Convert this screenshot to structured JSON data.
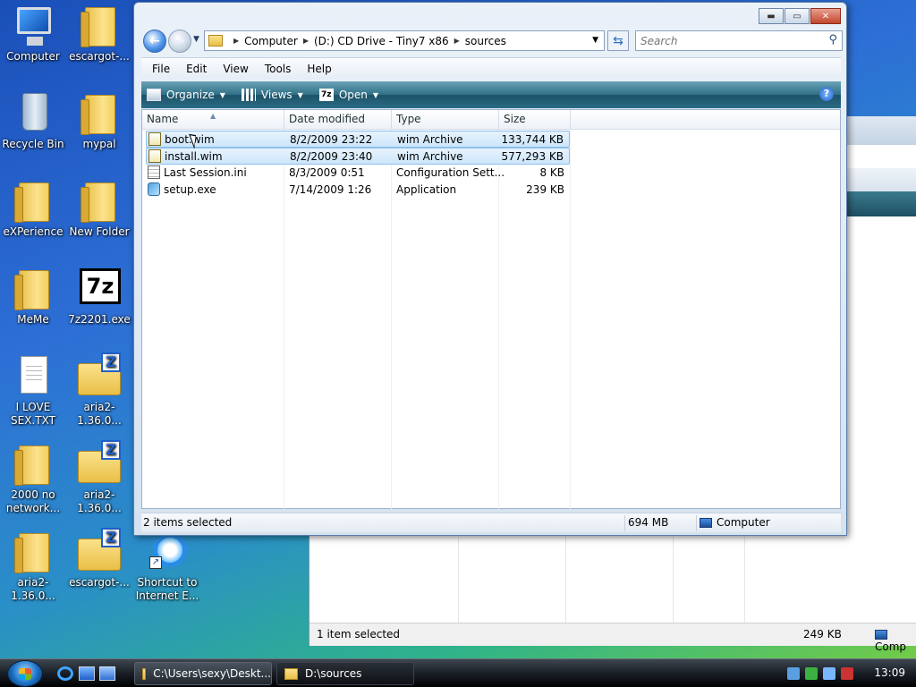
{
  "desktop": {
    "icons": [
      {
        "label": "Computer"
      },
      {
        "label": "escargot-..."
      },
      {
        "label": "Recycle Bin"
      },
      {
        "label": "mypal"
      },
      {
        "label": "eXPerience"
      },
      {
        "label": "New Folder"
      },
      {
        "label": "MeMe"
      },
      {
        "label": "7z2201.exe"
      },
      {
        "label": "I LOVE SEX.TXT"
      },
      {
        "label": "aria2-1.36.0..."
      },
      {
        "label": "2000 no network..."
      },
      {
        "label": "aria2-1.36.0..."
      },
      {
        "label": "aria2-1.36.0..."
      },
      {
        "label": "escargot-..."
      },
      {
        "label": "Shortcut to Internet E..."
      }
    ],
    "sevenz_text": "7z"
  },
  "explorer": {
    "address": {
      "segments": [
        "Computer",
        "(D:) CD Drive - Tiny7 x86",
        "sources"
      ]
    },
    "search": {
      "placeholder": "Search"
    },
    "menu": [
      "File",
      "Edit",
      "View",
      "Tools",
      "Help"
    ],
    "toolbar": {
      "organize": "Organize",
      "views": "Views",
      "open": "Open",
      "open_icon_text": "7z",
      "help_glyph": "?"
    },
    "columns": {
      "name": "Name",
      "date": "Date modified",
      "type": "Type",
      "size": "Size"
    },
    "files": [
      {
        "name": "boot.wim",
        "date": "8/2/2009 23:22",
        "type": "wim Archive",
        "size": "133,744 KB",
        "selected": true
      },
      {
        "name": "install.wim",
        "date": "8/2/2009 23:40",
        "type": "wim Archive",
        "size": "577,293 KB",
        "selected": true
      },
      {
        "name": "Last Session.ini",
        "date": "8/3/2009 0:51",
        "type": "Configuration Sett...",
        "size": "8 KB",
        "selected": false
      },
      {
        "name": "setup.exe",
        "date": "7/14/2009 1:26",
        "type": "Application",
        "size": "239 KB",
        "selected": false
      }
    ],
    "status": {
      "selection": "2 items selected",
      "total_size": "694 MB",
      "location": "Computer"
    }
  },
  "background_window": {
    "status": {
      "selection": "1 item selected",
      "size": "249 KB",
      "location": "Comp"
    }
  },
  "taskbar": {
    "tasks": [
      {
        "label": "C:\\Users\\sexy\\Deskt..."
      },
      {
        "label": "D:\\sources"
      }
    ],
    "clock": "13:09"
  },
  "colors": {
    "toolbar_teal": "#2f6f86",
    "selection_blue": "#cde6fb"
  }
}
